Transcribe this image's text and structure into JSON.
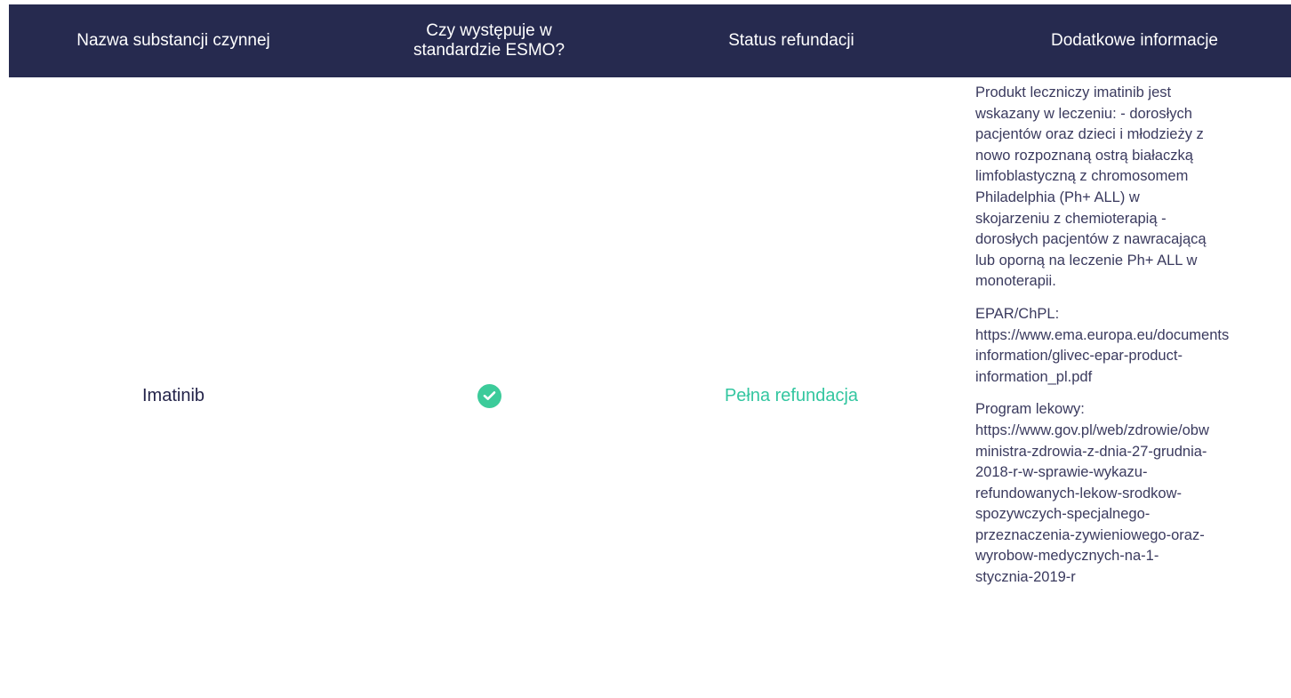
{
  "table": {
    "headers": [
      "Nazwa substancji czynnej",
      "Czy występuje w\nstandardzie ESMO?",
      "Status refundacji",
      "Dodatkowe informacje"
    ],
    "row": {
      "name": "Imatinib",
      "esmo_icon": "check-circle-icon",
      "status": "Pełna refundacja",
      "info": {
        "description": "Produkt leczniczy imatinib jest\nwskazany w leczeniu: - dorosłych\npacjentów oraz dzieci i młodzieży z\nnowo rozpoznaną ostrą białaczką\nlimfoblastyczną z chromosomem\nPhiladelphia (Ph+ ALL) w\nskojarzeniu z chemioterapią -\ndorosłych pacjentów z nawracającą\nlub oporną na leczenie Ph+ ALL w\nmonoterapii.",
        "epar": "EPAR/ChPL:\nhttps://www.ema.europa.eu/documents\ninformation/glivec-epar-product-\ninformation_pl.pdf",
        "program": "Program lekowy:\nhttps://www.gov.pl/web/zdrowie/obw\nministra-zdrowia-z-dnia-27-grudnia-\n2018-r-w-sprawie-wykazu-\nrefundowanych-lekow-srodkow-\nspozywczych-specjalnego-\nprzeznaczenia-zywieniowego-oraz-\nwyrobow-medycznych-na-1-\nstycznia-2019-r"
      }
    }
  },
  "colors": {
    "header_bg": "#262a4f",
    "accent_green": "#33c6a0"
  }
}
